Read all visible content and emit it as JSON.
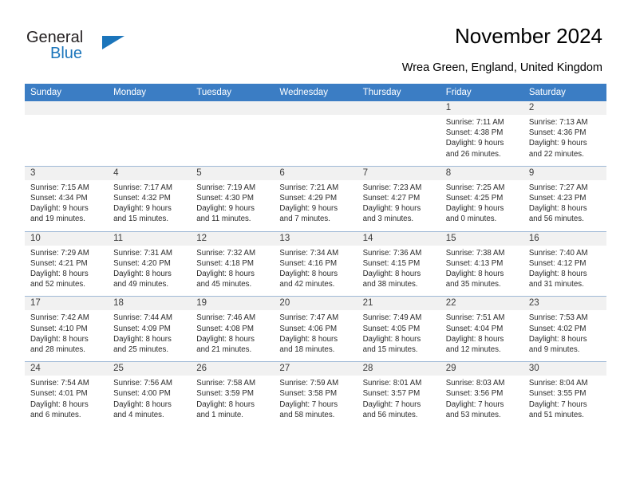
{
  "brand": {
    "name_top": "General",
    "name_bottom": "Blue",
    "accent_color": "#1b75bb"
  },
  "header": {
    "title": "November 2024",
    "subtitle": "Wrea Green, England, United Kingdom"
  },
  "calendar": {
    "header_bg": "#3b7dc4",
    "weekdays": [
      "Sunday",
      "Monday",
      "Tuesday",
      "Wednesday",
      "Thursday",
      "Friday",
      "Saturday"
    ],
    "weeks": [
      [
        {
          "day": "",
          "empty": true,
          "sunrise": "",
          "sunset": "",
          "daylight_line1": "",
          "daylight_line2": ""
        },
        {
          "day": "",
          "empty": true,
          "sunrise": "",
          "sunset": "",
          "daylight_line1": "",
          "daylight_line2": ""
        },
        {
          "day": "",
          "empty": true,
          "sunrise": "",
          "sunset": "",
          "daylight_line1": "",
          "daylight_line2": ""
        },
        {
          "day": "",
          "empty": true,
          "sunrise": "",
          "sunset": "",
          "daylight_line1": "",
          "daylight_line2": ""
        },
        {
          "day": "",
          "empty": true,
          "sunrise": "",
          "sunset": "",
          "daylight_line1": "",
          "daylight_line2": ""
        },
        {
          "day": "1",
          "empty": false,
          "sunrise": "Sunrise: 7:11 AM",
          "sunset": "Sunset: 4:38 PM",
          "daylight_line1": "Daylight: 9 hours",
          "daylight_line2": "and 26 minutes."
        },
        {
          "day": "2",
          "empty": false,
          "sunrise": "Sunrise: 7:13 AM",
          "sunset": "Sunset: 4:36 PM",
          "daylight_line1": "Daylight: 9 hours",
          "daylight_line2": "and 22 minutes."
        }
      ],
      [
        {
          "day": "3",
          "empty": false,
          "sunrise": "Sunrise: 7:15 AM",
          "sunset": "Sunset: 4:34 PM",
          "daylight_line1": "Daylight: 9 hours",
          "daylight_line2": "and 19 minutes."
        },
        {
          "day": "4",
          "empty": false,
          "sunrise": "Sunrise: 7:17 AM",
          "sunset": "Sunset: 4:32 PM",
          "daylight_line1": "Daylight: 9 hours",
          "daylight_line2": "and 15 minutes."
        },
        {
          "day": "5",
          "empty": false,
          "sunrise": "Sunrise: 7:19 AM",
          "sunset": "Sunset: 4:30 PM",
          "daylight_line1": "Daylight: 9 hours",
          "daylight_line2": "and 11 minutes."
        },
        {
          "day": "6",
          "empty": false,
          "sunrise": "Sunrise: 7:21 AM",
          "sunset": "Sunset: 4:29 PM",
          "daylight_line1": "Daylight: 9 hours",
          "daylight_line2": "and 7 minutes."
        },
        {
          "day": "7",
          "empty": false,
          "sunrise": "Sunrise: 7:23 AM",
          "sunset": "Sunset: 4:27 PM",
          "daylight_line1": "Daylight: 9 hours",
          "daylight_line2": "and 3 minutes."
        },
        {
          "day": "8",
          "empty": false,
          "sunrise": "Sunrise: 7:25 AM",
          "sunset": "Sunset: 4:25 PM",
          "daylight_line1": "Daylight: 9 hours",
          "daylight_line2": "and 0 minutes."
        },
        {
          "day": "9",
          "empty": false,
          "sunrise": "Sunrise: 7:27 AM",
          "sunset": "Sunset: 4:23 PM",
          "daylight_line1": "Daylight: 8 hours",
          "daylight_line2": "and 56 minutes."
        }
      ],
      [
        {
          "day": "10",
          "empty": false,
          "sunrise": "Sunrise: 7:29 AM",
          "sunset": "Sunset: 4:21 PM",
          "daylight_line1": "Daylight: 8 hours",
          "daylight_line2": "and 52 minutes."
        },
        {
          "day": "11",
          "empty": false,
          "sunrise": "Sunrise: 7:31 AM",
          "sunset": "Sunset: 4:20 PM",
          "daylight_line1": "Daylight: 8 hours",
          "daylight_line2": "and 49 minutes."
        },
        {
          "day": "12",
          "empty": false,
          "sunrise": "Sunrise: 7:32 AM",
          "sunset": "Sunset: 4:18 PM",
          "daylight_line1": "Daylight: 8 hours",
          "daylight_line2": "and 45 minutes."
        },
        {
          "day": "13",
          "empty": false,
          "sunrise": "Sunrise: 7:34 AM",
          "sunset": "Sunset: 4:16 PM",
          "daylight_line1": "Daylight: 8 hours",
          "daylight_line2": "and 42 minutes."
        },
        {
          "day": "14",
          "empty": false,
          "sunrise": "Sunrise: 7:36 AM",
          "sunset": "Sunset: 4:15 PM",
          "daylight_line1": "Daylight: 8 hours",
          "daylight_line2": "and 38 minutes."
        },
        {
          "day": "15",
          "empty": false,
          "sunrise": "Sunrise: 7:38 AM",
          "sunset": "Sunset: 4:13 PM",
          "daylight_line1": "Daylight: 8 hours",
          "daylight_line2": "and 35 minutes."
        },
        {
          "day": "16",
          "empty": false,
          "sunrise": "Sunrise: 7:40 AM",
          "sunset": "Sunset: 4:12 PM",
          "daylight_line1": "Daylight: 8 hours",
          "daylight_line2": "and 31 minutes."
        }
      ],
      [
        {
          "day": "17",
          "empty": false,
          "sunrise": "Sunrise: 7:42 AM",
          "sunset": "Sunset: 4:10 PM",
          "daylight_line1": "Daylight: 8 hours",
          "daylight_line2": "and 28 minutes."
        },
        {
          "day": "18",
          "empty": false,
          "sunrise": "Sunrise: 7:44 AM",
          "sunset": "Sunset: 4:09 PM",
          "daylight_line1": "Daylight: 8 hours",
          "daylight_line2": "and 25 minutes."
        },
        {
          "day": "19",
          "empty": false,
          "sunrise": "Sunrise: 7:46 AM",
          "sunset": "Sunset: 4:08 PM",
          "daylight_line1": "Daylight: 8 hours",
          "daylight_line2": "and 21 minutes."
        },
        {
          "day": "20",
          "empty": false,
          "sunrise": "Sunrise: 7:47 AM",
          "sunset": "Sunset: 4:06 PM",
          "daylight_line1": "Daylight: 8 hours",
          "daylight_line2": "and 18 minutes."
        },
        {
          "day": "21",
          "empty": false,
          "sunrise": "Sunrise: 7:49 AM",
          "sunset": "Sunset: 4:05 PM",
          "daylight_line1": "Daylight: 8 hours",
          "daylight_line2": "and 15 minutes."
        },
        {
          "day": "22",
          "empty": false,
          "sunrise": "Sunrise: 7:51 AM",
          "sunset": "Sunset: 4:04 PM",
          "daylight_line1": "Daylight: 8 hours",
          "daylight_line2": "and 12 minutes."
        },
        {
          "day": "23",
          "empty": false,
          "sunrise": "Sunrise: 7:53 AM",
          "sunset": "Sunset: 4:02 PM",
          "daylight_line1": "Daylight: 8 hours",
          "daylight_line2": "and 9 minutes."
        }
      ],
      [
        {
          "day": "24",
          "empty": false,
          "sunrise": "Sunrise: 7:54 AM",
          "sunset": "Sunset: 4:01 PM",
          "daylight_line1": "Daylight: 8 hours",
          "daylight_line2": "and 6 minutes."
        },
        {
          "day": "25",
          "empty": false,
          "sunrise": "Sunrise: 7:56 AM",
          "sunset": "Sunset: 4:00 PM",
          "daylight_line1": "Daylight: 8 hours",
          "daylight_line2": "and 4 minutes."
        },
        {
          "day": "26",
          "empty": false,
          "sunrise": "Sunrise: 7:58 AM",
          "sunset": "Sunset: 3:59 PM",
          "daylight_line1": "Daylight: 8 hours",
          "daylight_line2": "and 1 minute."
        },
        {
          "day": "27",
          "empty": false,
          "sunrise": "Sunrise: 7:59 AM",
          "sunset": "Sunset: 3:58 PM",
          "daylight_line1": "Daylight: 7 hours",
          "daylight_line2": "and 58 minutes."
        },
        {
          "day": "28",
          "empty": false,
          "sunrise": "Sunrise: 8:01 AM",
          "sunset": "Sunset: 3:57 PM",
          "daylight_line1": "Daylight: 7 hours",
          "daylight_line2": "and 56 minutes."
        },
        {
          "day": "29",
          "empty": false,
          "sunrise": "Sunrise: 8:03 AM",
          "sunset": "Sunset: 3:56 PM",
          "daylight_line1": "Daylight: 7 hours",
          "daylight_line2": "and 53 minutes."
        },
        {
          "day": "30",
          "empty": false,
          "sunrise": "Sunrise: 8:04 AM",
          "sunset": "Sunset: 3:55 PM",
          "daylight_line1": "Daylight: 7 hours",
          "daylight_line2": "and 51 minutes."
        }
      ]
    ]
  }
}
